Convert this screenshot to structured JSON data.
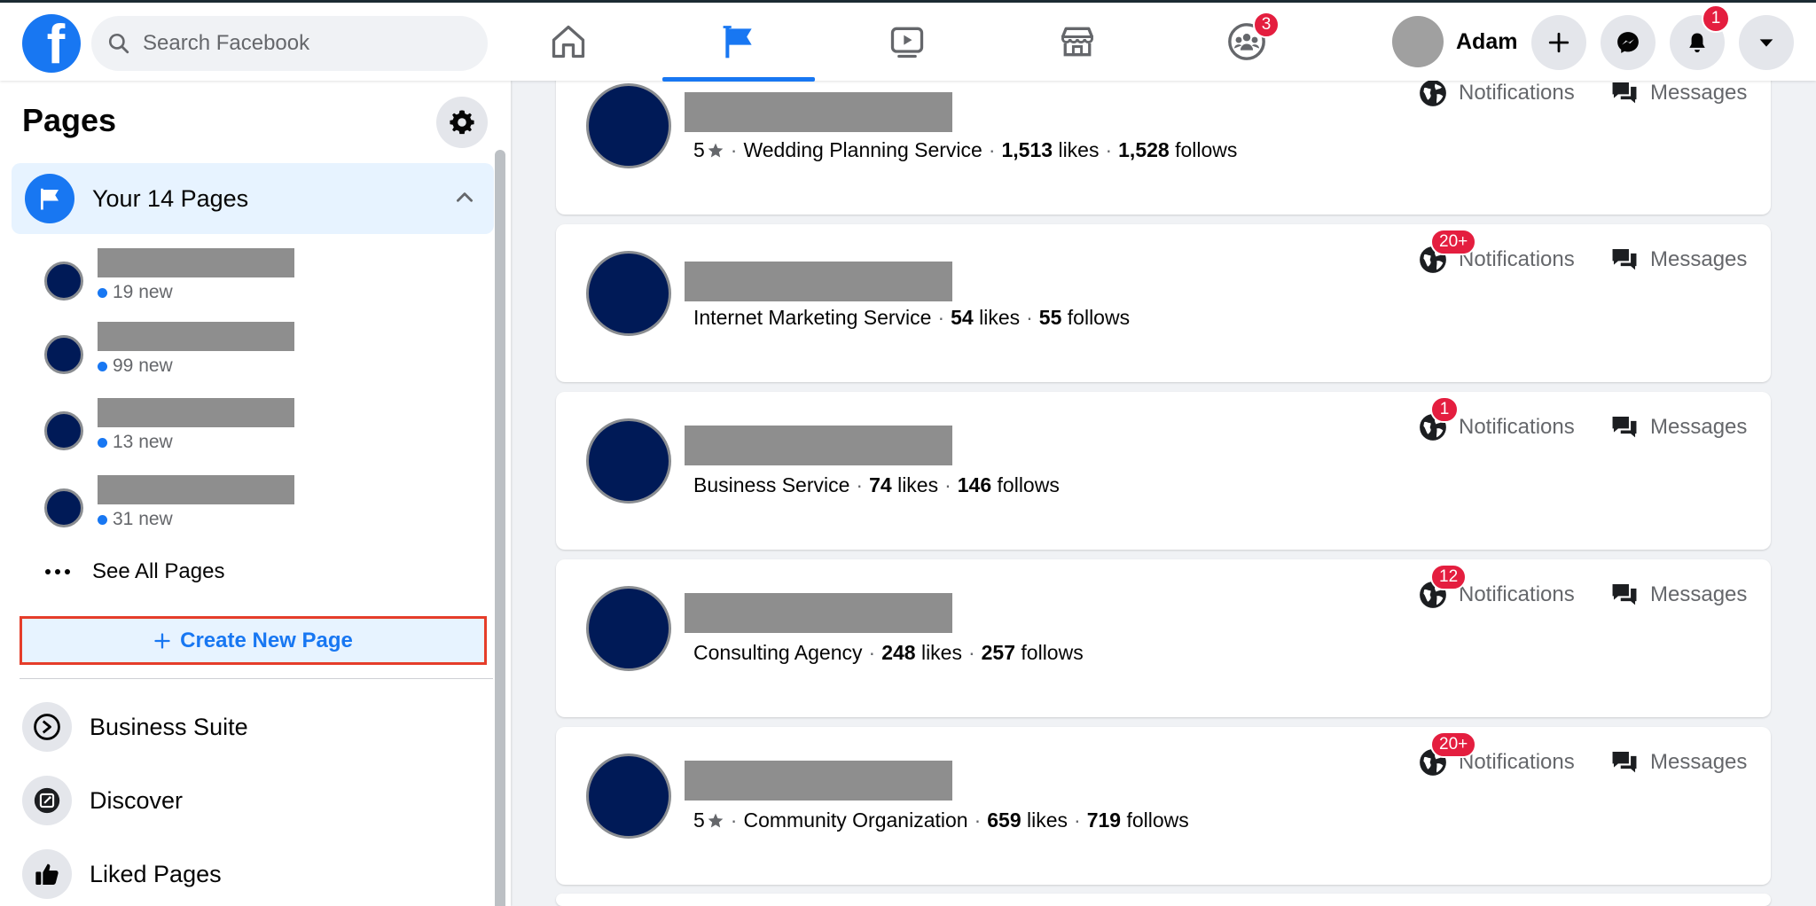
{
  "topbar": {
    "logo_letter": "f",
    "search_placeholder": "Search Facebook",
    "groups_badge": "3",
    "profile_name": "Adam",
    "notifications_badge": "1"
  },
  "sidebar": {
    "title": "Pages",
    "your_pages_label": "Your 14 Pages",
    "pages": [
      {
        "new_label": "19 new"
      },
      {
        "new_label": "99 new"
      },
      {
        "new_label": "13 new"
      },
      {
        "new_label": "31 new"
      }
    ],
    "see_all_label": "See All Pages",
    "create_label": "Create New Page",
    "links": [
      {
        "label": "Business Suite"
      },
      {
        "label": "Discover"
      },
      {
        "label": "Liked Pages"
      }
    ]
  },
  "feed": {
    "notifications_label": "Notifications",
    "messages_label": "Messages",
    "cards": [
      {
        "rating": "5",
        "category": "Wedding Planning Service",
        "likes": "1,513",
        "likes_label": "likes",
        "follows": "1,528",
        "follows_label": "follows",
        "badge": ""
      },
      {
        "rating": "",
        "category": "Internet Marketing Service",
        "likes": "54",
        "likes_label": "likes",
        "follows": "55",
        "follows_label": "follows",
        "badge": "20+"
      },
      {
        "rating": "",
        "category": "Business Service",
        "likes": "74",
        "likes_label": "likes",
        "follows": "146",
        "follows_label": "follows",
        "badge": "1"
      },
      {
        "rating": "",
        "category": "Consulting Agency",
        "likes": "248",
        "likes_label": "likes",
        "follows": "257",
        "follows_label": "follows",
        "badge": "12"
      },
      {
        "rating": "5",
        "category": "Community Organization",
        "likes": "659",
        "likes_label": "likes",
        "follows": "719",
        "follows_label": "follows",
        "badge": "20+"
      }
    ]
  },
  "colors": {
    "brand_blue": "#1877f2",
    "badge_red": "#e41e3f",
    "avatar_navy": "#001a57",
    "highlight_border": "#e53d2a"
  }
}
